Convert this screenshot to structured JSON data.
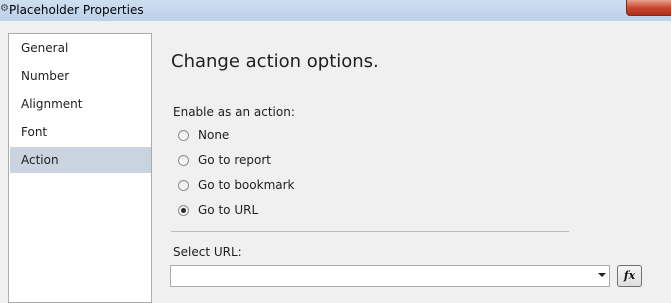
{
  "window": {
    "title": "Placeholder Properties",
    "title_icon": "app-icon",
    "close_icon": "close-icon"
  },
  "nav": {
    "items": [
      {
        "label": "General",
        "selected": false
      },
      {
        "label": "Number",
        "selected": false
      },
      {
        "label": "Alignment",
        "selected": false
      },
      {
        "label": "Font",
        "selected": false
      },
      {
        "label": "Action",
        "selected": true
      }
    ]
  },
  "main": {
    "heading": "Change action options.",
    "enable_label": "Enable as an action:",
    "options": [
      {
        "label": "None",
        "checked": false
      },
      {
        "label": "Go to report",
        "checked": false
      },
      {
        "label": "Go to bookmark",
        "checked": false
      },
      {
        "label": "Go to URL",
        "checked": true
      }
    ],
    "url_label": "Select URL:",
    "url_value": "",
    "fx_label": "fx"
  },
  "colors": {
    "selected_nav": "#c9d4e0",
    "title_bar": "#b9d1ea",
    "close_button": "#c6452c"
  }
}
